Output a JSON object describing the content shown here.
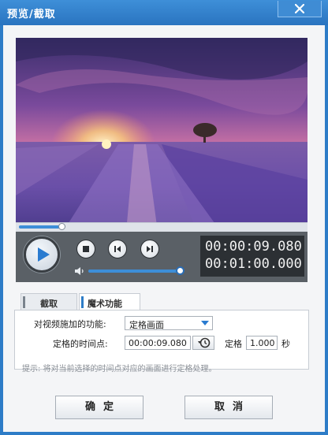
{
  "window": {
    "title": "预览/截取",
    "close_label": "close"
  },
  "player": {
    "current_time": "00:00:09.080",
    "total_time": "00:01:00.000",
    "seek_position": 0.15,
    "volume_level": 1.0,
    "icons": [
      "play-icon",
      "stop-icon",
      "step-back-icon",
      "step-forward-icon",
      "volume-icon",
      "chevron-down-icon"
    ]
  },
  "tabs": [
    {
      "label": "截取",
      "active": false
    },
    {
      "label": "魔术功能",
      "active": true
    }
  ],
  "form": {
    "effect_label": "对视频施加的功能:",
    "effect_value": "定格画面",
    "time_label": "定格的时间点:",
    "time_value": "00:00:09.080",
    "duration_label": "定格",
    "duration_value": "1.000",
    "duration_unit": "秒"
  },
  "hint": "提示: 将对当前选择的时间点对应的画面进行定格处理。",
  "buttons": {
    "ok": "确定",
    "cancel": "取消"
  },
  "colors": {
    "titlebar": "#2d7cc7",
    "accent": "#3d8ed8",
    "controls_bg": "#5a6066",
    "time_bg": "#2c3034"
  }
}
